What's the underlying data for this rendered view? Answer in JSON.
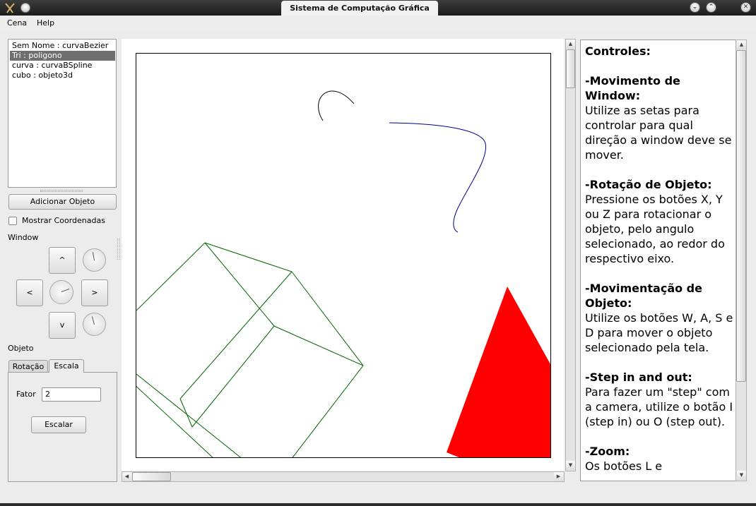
{
  "window": {
    "title": "Sistema de Computação Gráfica",
    "controls": [
      "chevron-down",
      "chevron-up",
      "close"
    ]
  },
  "menu": {
    "items": [
      {
        "label": "Cena"
      },
      {
        "label": "Help"
      }
    ]
  },
  "objects": {
    "items": [
      {
        "label": "Sem Nome : curvaBezier",
        "selected": false
      },
      {
        "label": "Tri : poligono",
        "selected": true
      },
      {
        "label": "curva : curvaBSpline",
        "selected": false
      },
      {
        "label": "cubo : objeto3d",
        "selected": false
      }
    ],
    "add_button": "Adicionar Objeto",
    "show_coords_label": "Mostrar Coordenadas",
    "show_coords_checked": false
  },
  "window_controls": {
    "section_label": "Window",
    "up": "^",
    "left": "<",
    "right": ">",
    "down": "v"
  },
  "object_controls": {
    "section_label": "Objeto",
    "tabs": [
      {
        "label": "Rotação",
        "active": false
      },
      {
        "label": "Escala",
        "active": true
      }
    ],
    "factor_label": "Fator",
    "factor_value": "2",
    "scale_button": "Escalar"
  },
  "scene": {
    "colors": {
      "bezier": "#000000",
      "bspline": "#00008b",
      "cube": "#006400",
      "triangle": "#ff0000"
    }
  },
  "help": {
    "title": "Controles:",
    "sections": [
      {
        "heading": "-Movimento de Window:",
        "text": "Utilize as setas para controlar para qual direção a window deve se mover."
      },
      {
        "heading": "-Rotação de Objeto:",
        "text": "Pressione os botões X, Y ou Z para rotacionar o objeto, pelo angulo selecionado, ao redor do respectivo eixo."
      },
      {
        "heading": "-Movimentação de Objeto:",
        "text": "Utilize os botões W, A, S e D para mover o objeto selecionado pela tela."
      },
      {
        "heading": "-Step in and out:",
        "text": "Para fazer um \"step\" com a camera, utilize o botão I (step in) ou O (step out)."
      },
      {
        "heading": "-Zoom:",
        "text": "Os botões  L e"
      }
    ]
  }
}
